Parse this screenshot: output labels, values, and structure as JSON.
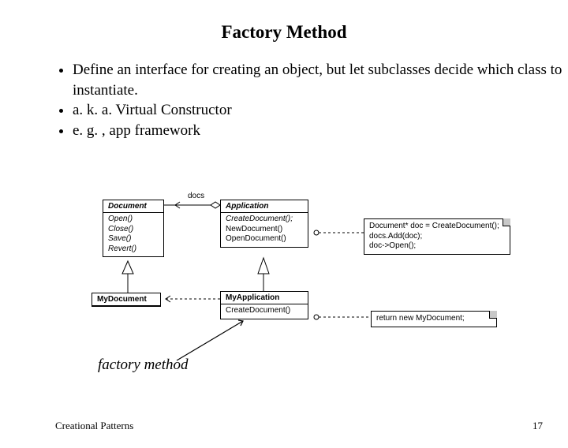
{
  "title": "Factory Method",
  "bullets": [
    "Define an interface for creating an object, but let subclasses decide which class to instantiate.",
    "a. k. a. Virtual Constructor",
    "e. g. , app framework"
  ],
  "diagram": {
    "document": {
      "name": "Document",
      "ops": [
        "Open()",
        "Close()",
        "Save()",
        "Revert()"
      ]
    },
    "application": {
      "name": "Application",
      "ops": [
        "CreateDocument();",
        "NewDocument()",
        "OpenDocument()"
      ]
    },
    "myDocument": {
      "name": "MyDocument"
    },
    "myApplication": {
      "name": "MyApplication",
      "ops": [
        "CreateDocument()"
      ]
    },
    "note1": [
      "Document* doc = CreateDocument();",
      "docs.Add(doc);",
      "doc->Open();"
    ],
    "note2": [
      "return new MyDocument;"
    ],
    "docs_label": "docs",
    "factory_method_label": "factory method"
  },
  "footer": {
    "left": "Creational Patterns",
    "page": "17"
  }
}
